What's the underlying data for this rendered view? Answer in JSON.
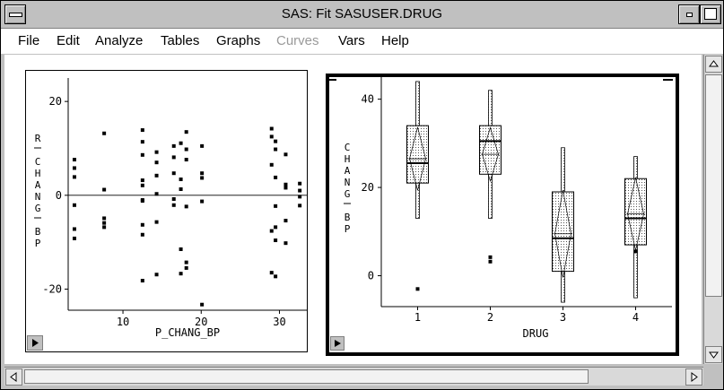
{
  "window": {
    "title": "SAS: Fit SASUSER.DRUG"
  },
  "menu": [
    {
      "label": "File",
      "enabled": true
    },
    {
      "label": "Edit",
      "enabled": true
    },
    {
      "label": "Analyze",
      "enabled": true
    },
    {
      "label": "Tables",
      "enabled": true
    },
    {
      "label": "Graphs",
      "enabled": true
    },
    {
      "label": "Curves",
      "enabled": false
    },
    {
      "label": "Vars",
      "enabled": true
    },
    {
      "label": "Help",
      "enabled": true
    }
  ],
  "icons": {
    "system_menu": "system-menu-icon",
    "minimize": "minimize-icon",
    "maximize": "maximize-icon",
    "panel_arrow": "triangle-right-icon"
  },
  "chart_data": [
    {
      "type": "scatter",
      "xlabel": "P_CHANG_BP",
      "ylabel": "R_CHANG_BP",
      "xlim": [
        3,
        33.5
      ],
      "ylim": [
        -24.5,
        25
      ],
      "xticks": [
        10,
        20,
        30
      ],
      "yticks": [
        20,
        0,
        -20
      ],
      "reference_line_y": 0,
      "points": [
        [
          3.8,
          7.6
        ],
        [
          3.8,
          5.8
        ],
        [
          3.8,
          3.9
        ],
        [
          3.8,
          -2.1
        ],
        [
          3.8,
          -7.2
        ],
        [
          3.8,
          -9.2
        ],
        [
          7.6,
          13.2
        ],
        [
          7.6,
          1.2
        ],
        [
          7.6,
          -4.9
        ],
        [
          7.6,
          -5.9
        ],
        [
          7.6,
          -6.8
        ],
        [
          12.5,
          13.9
        ],
        [
          12.5,
          11.4
        ],
        [
          12.5,
          8.6
        ],
        [
          12.5,
          3.2
        ],
        [
          12.5,
          2.1
        ],
        [
          12.5,
          -1.0
        ],
        [
          12.5,
          -1.2
        ],
        [
          12.5,
          -6.3
        ],
        [
          12.5,
          -8.4
        ],
        [
          12.5,
          -18.2
        ],
        [
          14.3,
          9.2
        ],
        [
          14.3,
          7.0
        ],
        [
          14.3,
          4.2
        ],
        [
          14.3,
          0.3
        ],
        [
          14.3,
          -5.7
        ],
        [
          14.3,
          -16.9
        ],
        [
          16.5,
          10.5
        ],
        [
          16.5,
          8.1
        ],
        [
          16.5,
          4.7
        ],
        [
          16.5,
          -0.8
        ],
        [
          16.5,
          -2.1
        ],
        [
          17.4,
          11.1
        ],
        [
          17.4,
          3.4
        ],
        [
          17.4,
          1.3
        ],
        [
          17.4,
          -11.5
        ],
        [
          17.4,
          -16.7
        ],
        [
          18.1,
          13.5
        ],
        [
          18.1,
          9.8
        ],
        [
          18.1,
          7.6
        ],
        [
          18.1,
          -2.4
        ],
        [
          18.1,
          -14.3
        ],
        [
          18.1,
          -15.5
        ],
        [
          20.1,
          10.5
        ],
        [
          20.1,
          4.7
        ],
        [
          20.1,
          3.7
        ],
        [
          20.1,
          -1.3
        ],
        [
          20.1,
          -23.3
        ],
        [
          29.0,
          14.2
        ],
        [
          29.0,
          12.5
        ],
        [
          29.0,
          6.5
        ],
        [
          29.0,
          -7.6
        ],
        [
          29.0,
          -16.5
        ],
        [
          29.5,
          11.5
        ],
        [
          29.5,
          9.8
        ],
        [
          29.5,
          3.8
        ],
        [
          29.5,
          -2.3
        ],
        [
          29.5,
          -6.8
        ],
        [
          29.5,
          -9.6
        ],
        [
          29.5,
          -17.3
        ],
        [
          30.8,
          8.7
        ],
        [
          30.8,
          2.3
        ],
        [
          30.8,
          1.6
        ],
        [
          30.8,
          -5.4
        ],
        [
          30.8,
          -10.2
        ],
        [
          32.6,
          2.5
        ],
        [
          32.6,
          1.0
        ],
        [
          32.6,
          -0.3
        ],
        [
          32.6,
          -2.2
        ]
      ]
    },
    {
      "type": "box",
      "xlabel": "DRUG",
      "ylabel": "CHANG_BP",
      "categories": [
        "1",
        "2",
        "3",
        "4"
      ],
      "ylim": [
        -7,
        45
      ],
      "yticks": [
        40,
        20,
        0
      ],
      "boxes": [
        {
          "category": "1",
          "whisker_low": 13,
          "q1": 21,
          "median": 25.5,
          "mean": 26.5,
          "q3": 34,
          "whisker_high": 44,
          "outliers": [
            -3
          ]
        },
        {
          "category": "2",
          "whisker_low": 13,
          "q1": 23,
          "median": 30.5,
          "mean": 27.5,
          "q3": 34,
          "whisker_high": 42,
          "outliers": [
            3.2,
            4.2
          ]
        },
        {
          "category": "3",
          "whisker_low": -6,
          "q1": 1,
          "median": 8.5,
          "mean": 9.5,
          "q3": 19,
          "whisker_high": 29,
          "outliers": []
        },
        {
          "category": "4",
          "whisker_low": -5,
          "q1": 7,
          "median": 13,
          "mean": 14,
          "q3": 22,
          "whisker_high": 27,
          "outliers": [
            5.5
          ]
        }
      ]
    }
  ]
}
